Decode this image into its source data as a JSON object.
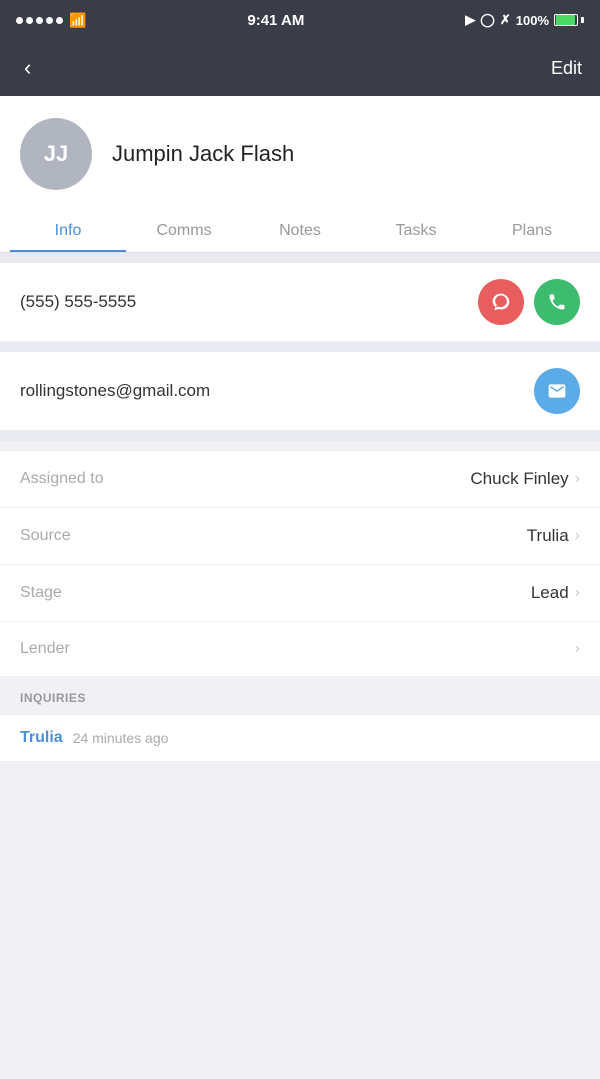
{
  "statusBar": {
    "time": "9:41 AM",
    "battery": "100%",
    "signal": "●●●●●"
  },
  "navBar": {
    "backLabel": "‹",
    "editLabel": "Edit"
  },
  "contact": {
    "initials": "JJ",
    "name": "Jumpin Jack Flash",
    "phone": "(555) 555-5555",
    "email": "rollingstones@gmail.com"
  },
  "tabs": [
    {
      "id": "info",
      "label": "Info",
      "active": true
    },
    {
      "id": "comms",
      "label": "Comms",
      "active": false
    },
    {
      "id": "notes",
      "label": "Notes",
      "active": false
    },
    {
      "id": "tasks",
      "label": "Tasks",
      "active": false
    },
    {
      "id": "plans",
      "label": "Plans",
      "active": false
    }
  ],
  "details": [
    {
      "label": "Assigned to",
      "value": "Chuck Finley",
      "hasChevron": true
    },
    {
      "label": "Source",
      "value": "Trulia",
      "hasChevron": true
    },
    {
      "label": "Stage",
      "value": "Lead",
      "hasChevron": true
    },
    {
      "label": "Lender",
      "value": "",
      "hasChevron": true
    }
  ],
  "inquiries": {
    "sectionLabel": "INQUIRIES",
    "items": [
      {
        "source": "Trulia",
        "time": "24 minutes ago"
      }
    ]
  },
  "buttons": {
    "messageTitle": "Message",
    "callTitle": "Call",
    "emailTitle": "Email"
  }
}
